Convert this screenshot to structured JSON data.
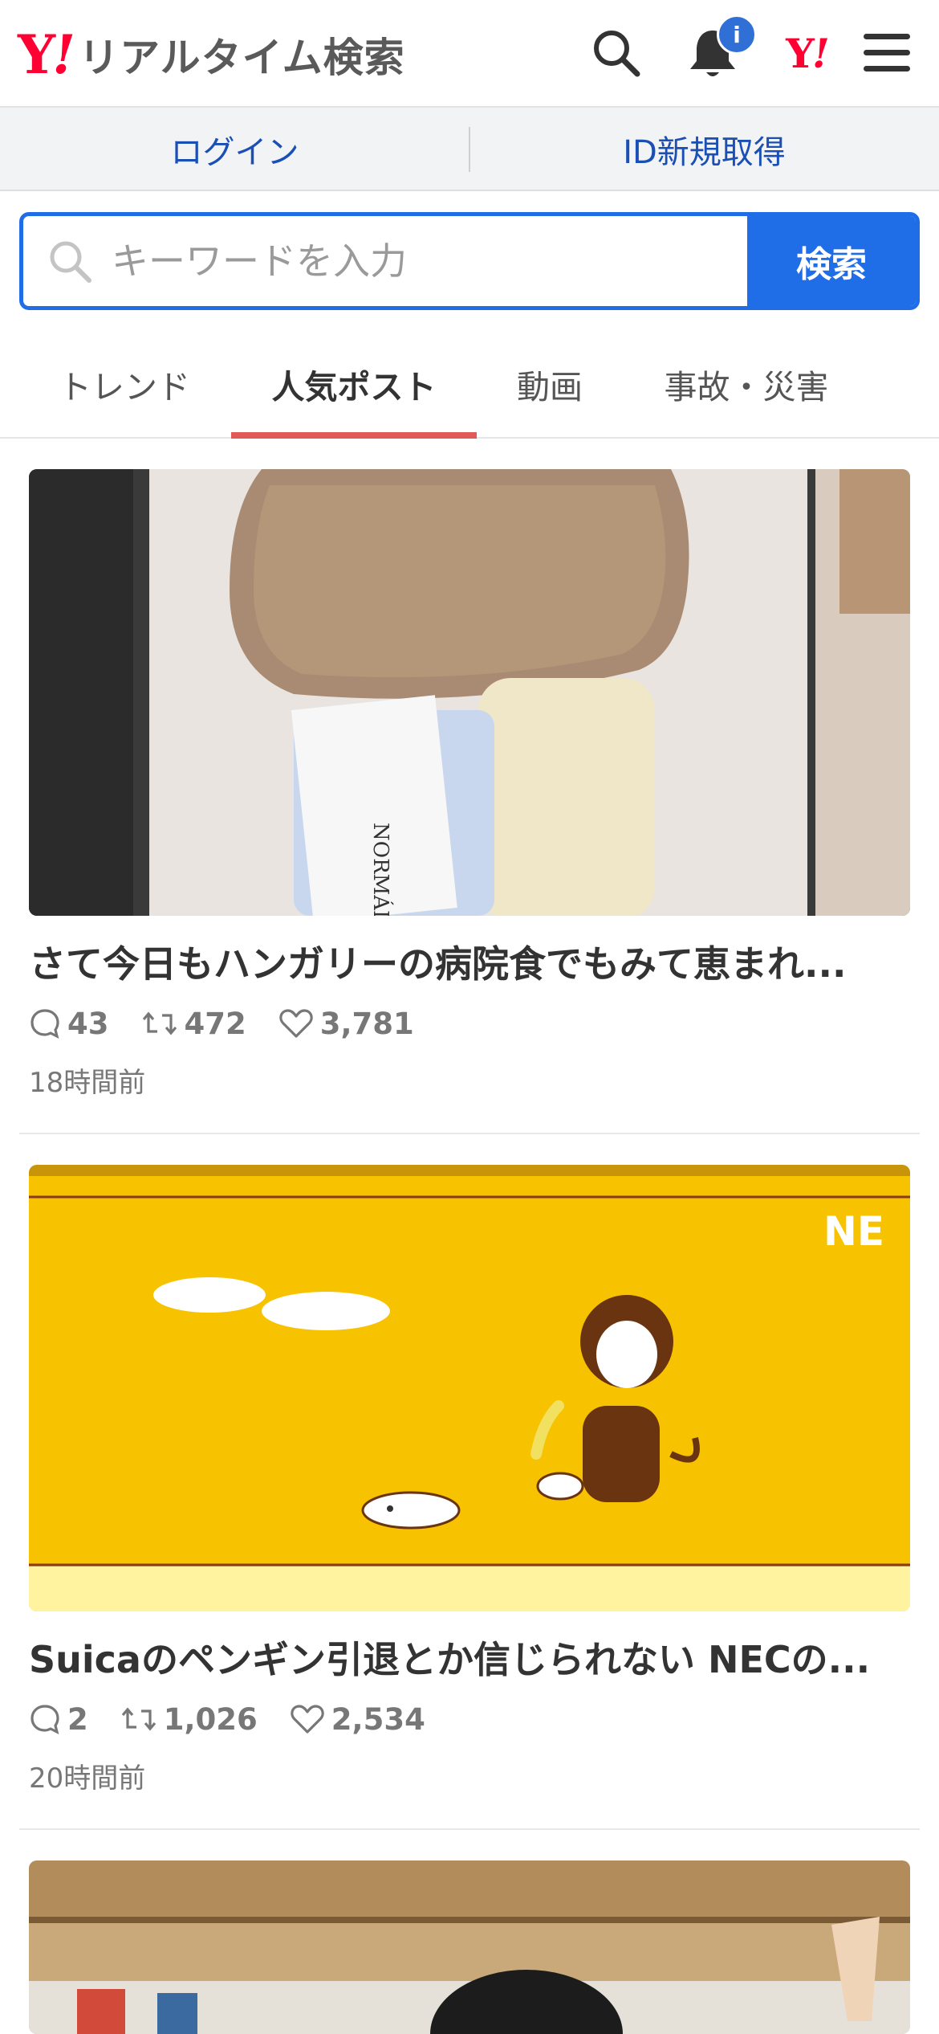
{
  "header": {
    "logo_mark": "Y!",
    "logo_text": "リアルタイム検索",
    "badge": "i",
    "yjapan_mark": "Y!"
  },
  "loginbar": {
    "login": "ログイン",
    "signup": "ID新規取得"
  },
  "search": {
    "placeholder": "キーワードを入力",
    "button": "検索"
  },
  "tabs": [
    "トレンド",
    "人気ポスト",
    "動画",
    "事故・災害"
  ],
  "active_tab": "人気ポスト",
  "posts": [
    {
      "title": "さて今日もハンガリーの病院食でもみて恵まれ...",
      "replies": "43",
      "reposts": "472",
      "likes": "3,781",
      "time": "18時間前",
      "image_label": "NORMÁL"
    },
    {
      "title": "Suicaのペンギン引退とか信じられない NECの...",
      "replies": "2",
      "reposts": "1,026",
      "likes": "2,534",
      "time": "20時間前",
      "image_label": "NE"
    },
    {
      "title": "",
      "replies": "",
      "reposts": "",
      "likes": "",
      "time": ""
    }
  ],
  "colors": {
    "brand_red": "#ff0033",
    "accent_blue": "#1f6ee8",
    "tab_indicator": "#e05a5a"
  }
}
